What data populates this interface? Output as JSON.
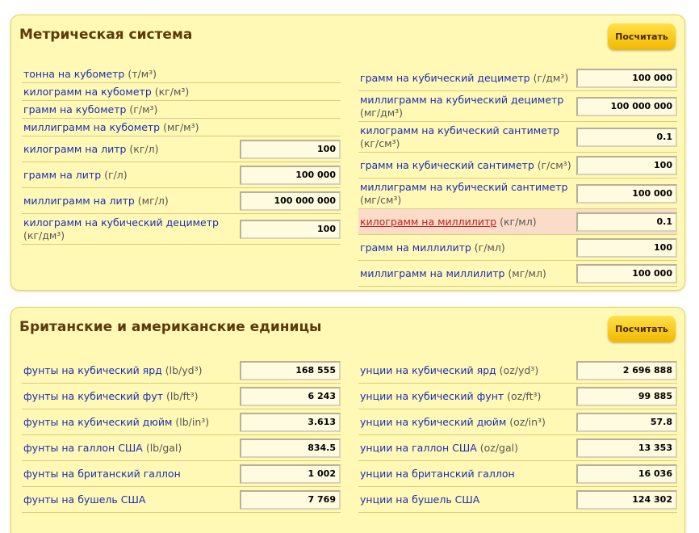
{
  "metric": {
    "title": "Метрическая система",
    "button": "Посчитать",
    "left": [
      {
        "unit": "тонна на кубометр",
        "abbr": " (т/м³)",
        "value": null
      },
      {
        "unit": "килограмм на кубометр",
        "abbr": " (кг/м³)",
        "value": null
      },
      {
        "unit": "грамм на кубометр",
        "abbr": " (г/м³)",
        "value": null
      },
      {
        "unit": "миллиграмм на кубометр",
        "abbr": " (мг/м³)",
        "value": null
      },
      {
        "unit": "килограмм на литр",
        "abbr": " (кг/л)",
        "value": "100"
      },
      {
        "unit": "грамм на литр",
        "abbr": " (г/л)",
        "value": "100 000"
      },
      {
        "unit": "миллиграмм на литр",
        "abbr": " (мг/л)",
        "value": "100 000 000"
      },
      {
        "unit": "килограмм на кубический дециметр",
        "abbr": " (кг/дм³)",
        "value": "100"
      }
    ],
    "right": [
      {
        "unit": "грамм на кубический дециметр",
        "abbr": " (г/дм³)",
        "value": "100 000"
      },
      {
        "unit": "миллиграмм на кубический дециметр",
        "abbr": " (мг/дм³)",
        "value": "100 000 000"
      },
      {
        "unit": "килограмм на кубический сантиметр",
        "abbr": " (кг/см³)",
        "value": "0.1"
      },
      {
        "unit": "грамм на кубический сантиметр",
        "abbr": " (г/см³)",
        "value": "100"
      },
      {
        "unit": "миллиграмм на кубический сантиметр",
        "abbr": " (мг/см³)",
        "value": "100 000"
      },
      {
        "unit": "килограмм на миллилитр",
        "abbr": " (кг/мл)",
        "value": "0.1"
      },
      {
        "unit": "грамм на миллилитр",
        "abbr": " (г/мл)",
        "value": "100"
      },
      {
        "unit": "миллиграмм на миллилитр",
        "abbr": " (мг/мл)",
        "value": "100 000"
      }
    ]
  },
  "british": {
    "title": "Британские и американские единицы",
    "button": "Посчитать",
    "left": [
      {
        "unit": "фунты на кубический ярд",
        "abbr": " (lb/yd³)",
        "value": "168 555"
      },
      {
        "unit": "фунты на кубический фут",
        "abbr": " (lb/ft³)",
        "value": "6 243"
      },
      {
        "unit": "фунты на кубический дюйм",
        "abbr": " (lb/in³)",
        "value": "3.613"
      },
      {
        "unit": "фунты на галлон США",
        "abbr": " (lb/gal)",
        "value": "834.5"
      },
      {
        "unit": "фунты на британский галлон",
        "abbr": "",
        "value": "1 002"
      },
      {
        "unit": "фунты на бушель США",
        "abbr": "",
        "value": "7 769"
      }
    ],
    "right": [
      {
        "unit": "унции на кубический ярд",
        "abbr": " (oz/yd³)",
        "value": "2 696 888"
      },
      {
        "unit": "унции на кубический фунт",
        "abbr": " (oz/ft³)",
        "value": "99 885"
      },
      {
        "unit": "унции на кубический дюйм",
        "abbr": " (oz/in³)",
        "value": "57.8"
      },
      {
        "unit": "унции на галлон США",
        "abbr": " (oz/gal)",
        "value": "13 353"
      },
      {
        "unit": "унции на британский галлон",
        "abbr": "",
        "value": "16 036"
      },
      {
        "unit": "унции на бушель США",
        "abbr": "",
        "value": "124 302"
      }
    ]
  },
  "colors": {
    "panel_bg": "#fff9b5",
    "title": "#5c3a0c",
    "link": "#1a2fb3",
    "highlight_bg": "#fbdcc8",
    "button": "#f2b800"
  }
}
